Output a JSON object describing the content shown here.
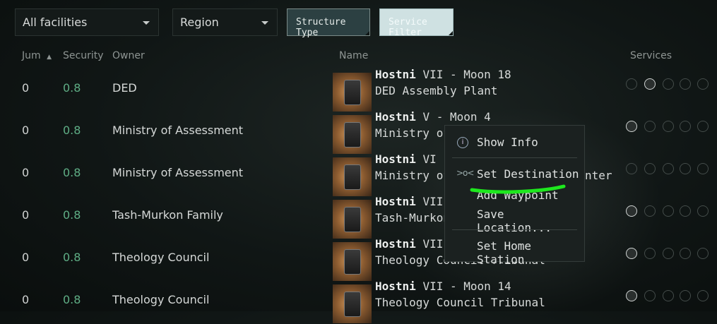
{
  "filters": {
    "facilities": "All facilities",
    "region": "Region",
    "structure_type": "Structure Type",
    "service_filter": "Service Filter"
  },
  "headers": {
    "jumps": "Jum",
    "security": "Security",
    "owner": "Owner",
    "name": "Name",
    "services": "Services"
  },
  "rows": [
    {
      "jumps": "0",
      "security": "0.8",
      "owner": "DED",
      "name_sys": "Hostni",
      "name_loc": "VII - Moon 18",
      "name_sub": "DED Assembly Plant"
    },
    {
      "jumps": "0",
      "security": "0.8",
      "owner": "Ministry of Assessment",
      "name_sys": "Hostni",
      "name_loc": "V - Moon 4",
      "name_sub": "Ministry of A"
    },
    {
      "jumps": "0",
      "security": "0.8",
      "owner": "Ministry of Assessment",
      "name_sys": "Hostni",
      "name_loc": "VI - M",
      "name_sub": "Ministry of A",
      "name_sub_tail": "nter"
    },
    {
      "jumps": "0",
      "security": "0.8",
      "owner": "Tash-Murkon Family",
      "name_sys": "Hostni",
      "name_loc": "VII -",
      "name_sub": "Tash-Murkon"
    },
    {
      "jumps": "0",
      "security": "0.8",
      "owner": "Theology Council",
      "name_sys": "Hostni",
      "name_loc": "VII -",
      "name_sub": "Theology Council Tribunal"
    },
    {
      "jumps": "0",
      "security": "0.8",
      "owner": "Theology Council",
      "name_sys": "Hostni",
      "name_loc": "VII - Moon 14",
      "name_sub": "Theology Council Tribunal"
    }
  ],
  "context_menu": {
    "show_info": "Show Info",
    "set_destination": "Set Destination",
    "add_waypoint": "Add Waypoint",
    "save_location": "Save Location...",
    "set_home_station": "Set Home Station"
  },
  "colors": {
    "security": "#5fae85",
    "annotation": "#1ee81e"
  }
}
